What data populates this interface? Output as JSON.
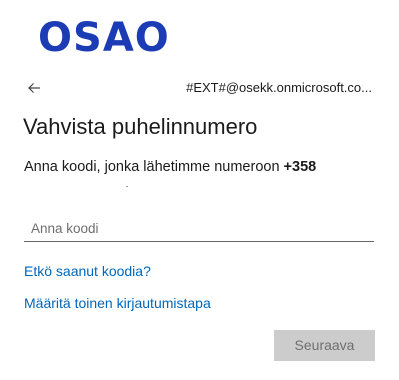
{
  "brand": {
    "logo_text": "OSAO",
    "logo_color": "#1b3cb5"
  },
  "identity": {
    "back_icon": "back-arrow-icon",
    "account": "#EXT#@osekk.onmicrosoft.co..."
  },
  "heading": {
    "title": "Vahvista puhelinnumero"
  },
  "description": {
    "text": "Anna koodi, jonka lähetimme numeroon ",
    "number": "+358"
  },
  "form": {
    "code_placeholder": "Anna koodi",
    "code_value": ""
  },
  "links": {
    "resend": "Etkö saanut koodia?",
    "other_method": "Määritä toinen kirjautumistapa"
  },
  "actions": {
    "next_label": "Seuraava",
    "next_disabled": true
  },
  "colors": {
    "link": "#0067b8",
    "text": "#1b1b1b",
    "button_disabled_bg": "#cccccc",
    "button_disabled_text": "#6f6f6f"
  }
}
